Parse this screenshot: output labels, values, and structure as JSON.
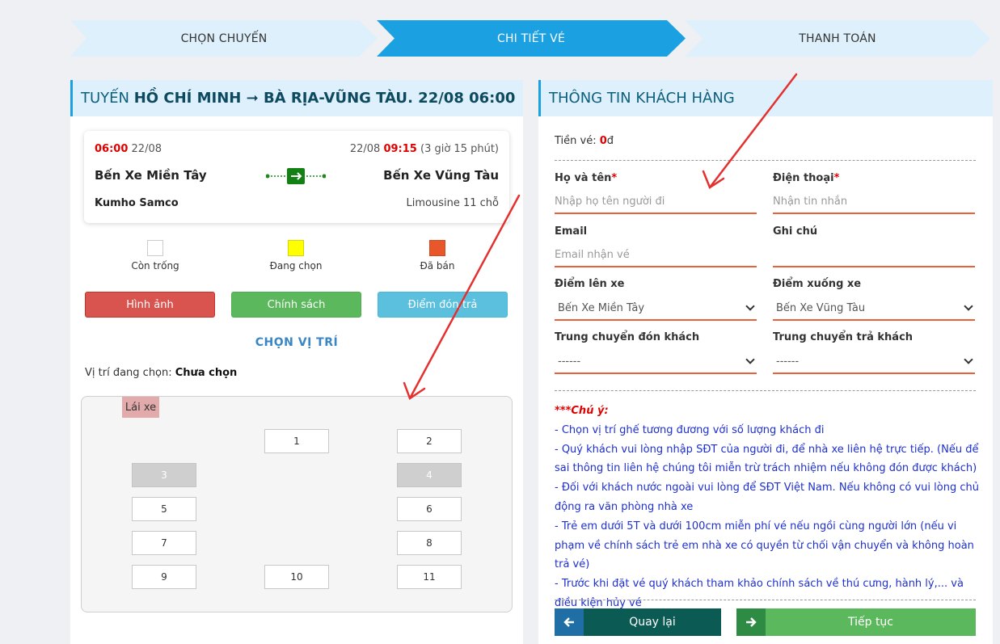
{
  "steps": [
    "CHỌN CHUYẾN",
    "CHI TIẾT VÉ",
    "THANH TOÁN"
  ],
  "route": {
    "prefix": "TUYẾN ",
    "name": "HỒ CHÍ MINH ➞ BÀ RỊA-VŨNG TÀU",
    "suffix": ". 22/08 06:00"
  },
  "trip": {
    "depart_time": "06:00",
    "depart_date": "22/08",
    "arrive_date": "22/08",
    "arrive_time": "09:15",
    "duration": "(3 giờ 15 phút)",
    "from": "Bến Xe Miền Tây",
    "to": "Bến Xe Vũng Tàu",
    "operator": "Kumho Samco",
    "vehicle": "Limousine 11 chỗ"
  },
  "legend": [
    {
      "label": "Còn trống",
      "color": "#ffffff"
    },
    {
      "label": "Đang chọn",
      "color": "#ffff00"
    },
    {
      "label": "Đã bán",
      "color": "#e8562a"
    }
  ],
  "buttons": {
    "images": "Hình ảnh",
    "policy": "Chính sách",
    "pickup": "Điểm đón/trả"
  },
  "choose_title": "CHỌN VỊ TRÍ",
  "current": {
    "label": "Vị trí đang chọn: ",
    "value": "Chưa chọn"
  },
  "driver": "Lái xe",
  "seats": [
    "1",
    "2",
    "3",
    "4",
    "5",
    "6",
    "7",
    "8",
    "9",
    "10",
    "11"
  ],
  "customer": {
    "title": "THÔNG TIN KHÁCH HÀNG",
    "price_label": "Tiền vé: ",
    "price_value": "0",
    "price_unit": "đ",
    "name_label": "Họ và tên",
    "name_placeholder": "Nhập họ tên người đi",
    "phone_label": "Điện thoại",
    "phone_placeholder": "Nhận tin nhắn",
    "email_label": "Email",
    "email_placeholder": "Email nhận vé",
    "note_label": "Ghi chú",
    "board_label": "Điểm lên xe",
    "board_value": "Bến Xe Miền Tây",
    "drop_label": "Điểm xuống xe",
    "drop_value": "Bến Xe Vũng Tàu",
    "transfer_pick_label": "Trung chuyển đón khách",
    "transfer_pick_value": "------",
    "transfer_drop_label": "Trung chuyển trả khách",
    "transfer_drop_value": "------"
  },
  "notes": {
    "title": "***Chú ý:",
    "lines": [
      "- Chọn vị trí ghế tương đương với số lượng khách đi",
      "- Quý khách vui lòng nhập SĐT của người đi, để nhà xe liên hệ trực tiếp. (Nếu để sai thông tin liên hệ chúng tôi miễn trừ trách nhiệm nếu không đón được khách)",
      "- Đối với khách nước ngoài vui lòng để SĐT Việt Nam. Nếu không có vui lòng chủ động ra văn phòng nhà xe",
      "- Trẻ em dưới 5T và dưới 100cm miễn phí vé nếu ngồi cùng người lớn (nếu vi phạm về chính sách trẻ em nhà xe có quyền từ chối vận chuyển và không hoàn trả vé)",
      "- Trước khi đặt vé quý khách tham khảo chính sách về thú cưng, hành lý,... và điều kiện hủy vé"
    ]
  },
  "actions": {
    "back": "Quay lại",
    "next": "Tiếp tục"
  }
}
